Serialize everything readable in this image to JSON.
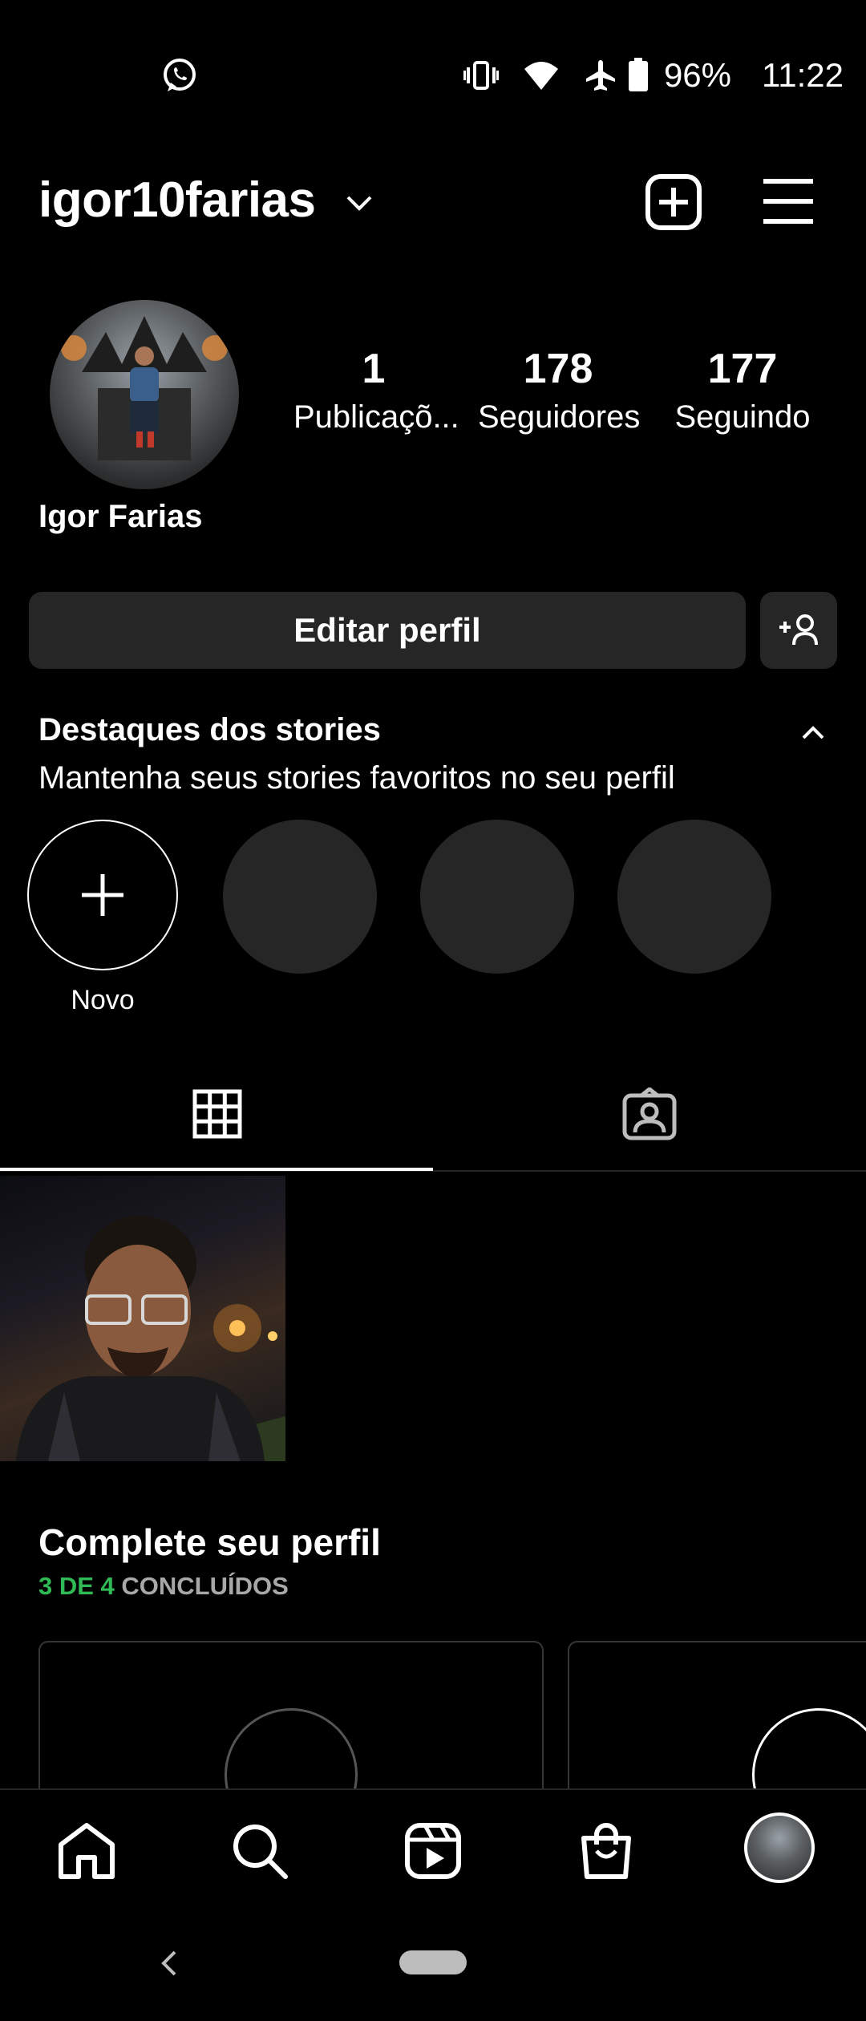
{
  "status_bar": {
    "battery_percent": "96%",
    "time": "11:22",
    "icons": [
      "whatsapp-icon",
      "vibrate-icon",
      "wifi-icon",
      "airplane-icon",
      "battery-icon"
    ]
  },
  "header": {
    "username": "igor10farias",
    "icons": [
      "chevron-down-icon",
      "new-post-icon",
      "menu-icon"
    ]
  },
  "profile": {
    "full_name": "Igor Farias",
    "stats": [
      {
        "value": "1",
        "label": "Publicaçõ..."
      },
      {
        "value": "178",
        "label": "Seguidores"
      },
      {
        "value": "177",
        "label": "Seguindo"
      }
    ]
  },
  "actions": {
    "edit_label": "Editar perfil",
    "discover_icon": "add-person-icon"
  },
  "highlights": {
    "title": "Destaques dos stories",
    "subtitle": "Mantenha seus stories favoritos no seu perfil",
    "new_label": "Novo"
  },
  "tabs": [
    "grid-icon",
    "tagged-icon"
  ],
  "complete_profile": {
    "title": "Complete seu perfil",
    "progress_done": "3 DE 4",
    "progress_rest": "CONCLUÍDOS",
    "colors": {
      "done": "#2fba55",
      "rest": "#a8a8a8"
    }
  },
  "bottom_nav": [
    "home-icon",
    "search-icon",
    "reels-icon",
    "shop-icon",
    "profile-avatar"
  ],
  "colors": {
    "background": "#000000",
    "button": "#262626",
    "text": "#ffffff"
  }
}
